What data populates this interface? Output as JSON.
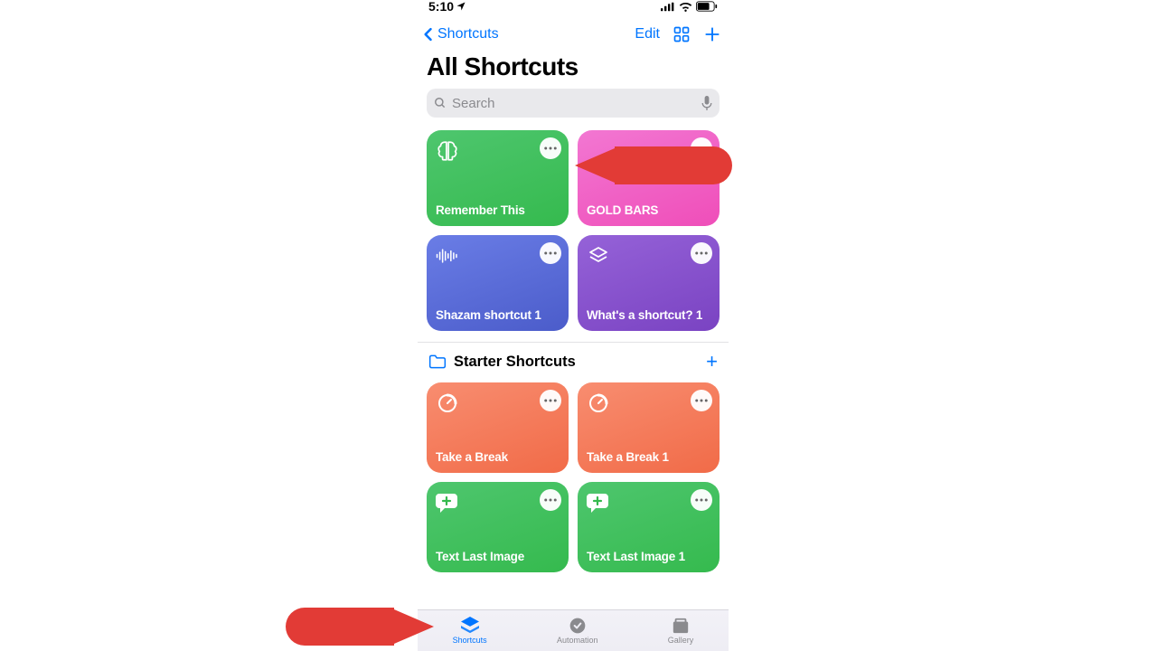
{
  "status": {
    "time": "5:10"
  },
  "nav": {
    "back_label": "Shortcuts",
    "edit_label": "Edit"
  },
  "title": "All Shortcuts",
  "search": {
    "placeholder": "Search"
  },
  "shortcuts": [
    {
      "label": "Remember This",
      "color": "green1",
      "icon": "brain"
    },
    {
      "label": "GOLD BARS",
      "color": "pink1",
      "icon": "none"
    },
    {
      "label": "Shazam shortcut 1",
      "color": "blue1",
      "icon": "waveform"
    },
    {
      "label": "What's a shortcut? 1",
      "color": "purple1",
      "icon": "layers"
    }
  ],
  "section_header": "Starter Shortcuts",
  "starter": [
    {
      "label": "Take a Break",
      "color": "orange1",
      "icon": "timer"
    },
    {
      "label": "Take a Break 1",
      "color": "orange1",
      "icon": "timer"
    },
    {
      "label": "Text Last Image",
      "color": "green2",
      "icon": "speech-plus"
    },
    {
      "label": "Text Last Image 1",
      "color": "green2",
      "icon": "speech-plus"
    }
  ],
  "tabs": {
    "shortcuts": "Shortcuts",
    "automation": "Automation",
    "gallery": "Gallery"
  }
}
